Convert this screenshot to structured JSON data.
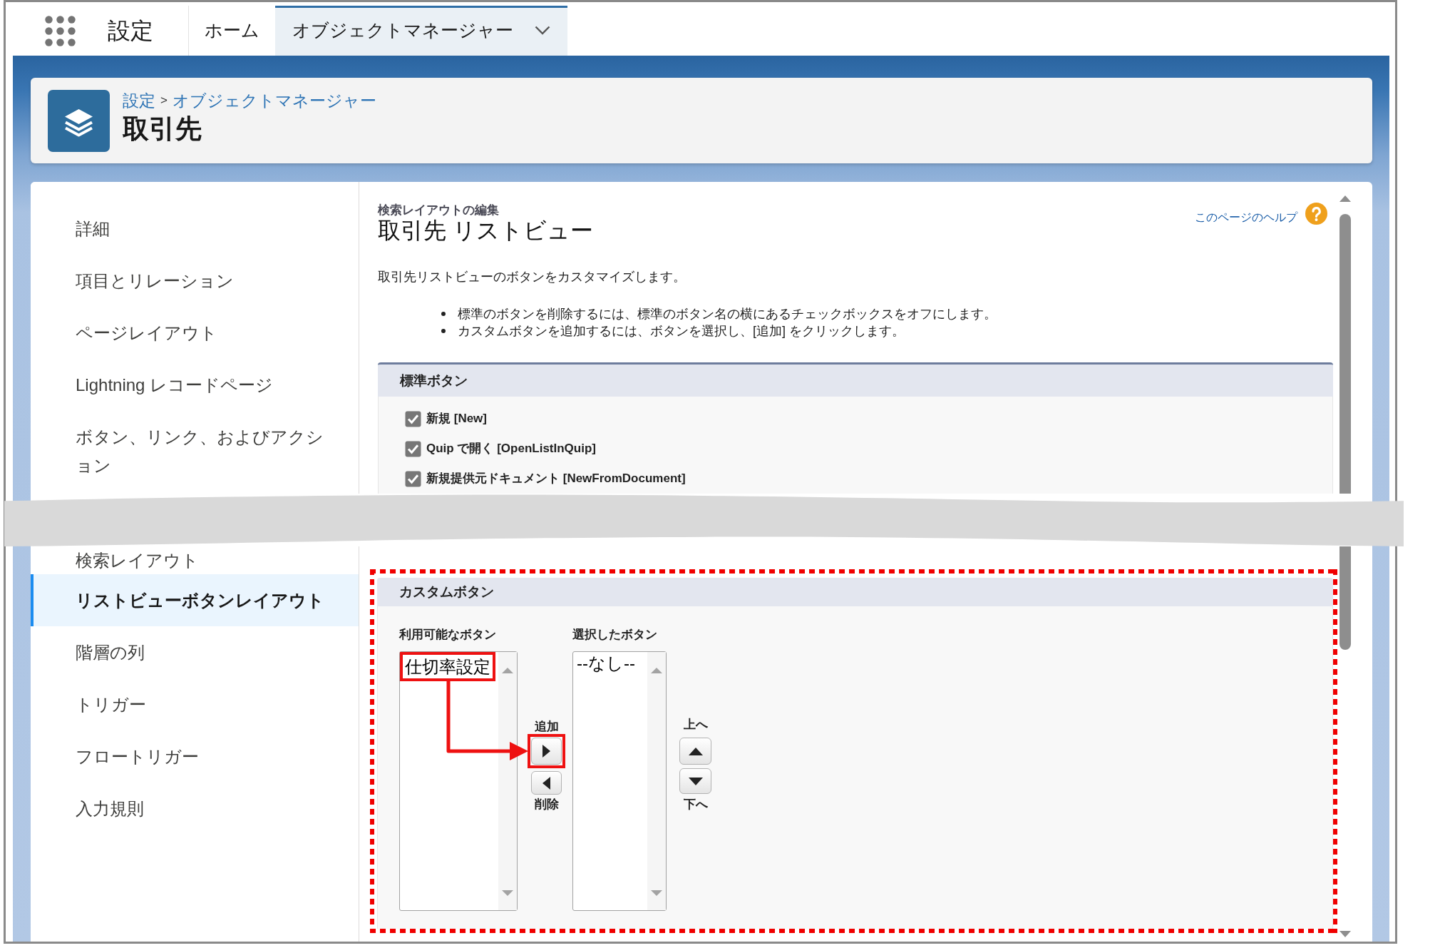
{
  "top_nav": {
    "app_name": "設定",
    "tabs": [
      {
        "label": "ホーム",
        "selected": false,
        "menu": false
      },
      {
        "label": "オブジェクトマネージャー",
        "selected": true,
        "menu": true
      }
    ]
  },
  "header": {
    "breadcrumb": [
      "設定",
      "オブジェクトマネージャー"
    ],
    "breadcrumb_separator": ">",
    "title": "取引先"
  },
  "sidebar": {
    "items_above_cut": [
      {
        "label": "詳細",
        "selected": false
      },
      {
        "label": "項目とリレーション",
        "selected": false
      },
      {
        "label": "ページレイアウト",
        "selected": false
      },
      {
        "label": "Lightning レコードページ",
        "selected": false
      },
      {
        "label": "ボタン、リンク、およびアクション",
        "selected": false
      }
    ],
    "items_below_cut": [
      {
        "label": "検索レイアウト",
        "selected": false
      },
      {
        "label": "リストビューボタンレイアウト",
        "selected": true
      },
      {
        "label": "階層の列",
        "selected": false
      },
      {
        "label": "トリガー",
        "selected": false
      },
      {
        "label": "フロートリガー",
        "selected": false
      },
      {
        "label": "入力規則",
        "selected": false
      }
    ]
  },
  "content": {
    "subtitle": "検索レイアウトの編集",
    "title": "取引先 リストビュー",
    "help_link": "このページのヘルプ",
    "description": "取引先リストビューのボタンをカスタマイズします。",
    "instructions": [
      "標準のボタンを削除するには、標準のボタン名の横にあるチェックボックスをオフにします。",
      "カスタムボタンを追加するには、ボタンを選択し、[追加] をクリックします。"
    ],
    "standard_buttons": {
      "title": "標準ボタン",
      "items": [
        {
          "label": "新規 [New]",
          "checked": true
        },
        {
          "label": "Quip で開く [OpenListInQuip]",
          "checked": true
        },
        {
          "label": "新規提供元ドキュメント [NewFromDocument]",
          "checked": true
        }
      ]
    },
    "custom_buttons": {
      "title": "カスタムボタン",
      "highlighted": true,
      "available": {
        "label": "利用可能なボタン",
        "options": [
          {
            "label": "仕切率設定",
            "highlighted": true
          }
        ]
      },
      "add": {
        "label": "追加",
        "highlighted": true
      },
      "remove": {
        "label": "削除"
      },
      "selected_list": {
        "label": "選択したボタン",
        "options": [
          {
            "label": "--なし--"
          }
        ]
      },
      "move_up": {
        "label": "上へ"
      },
      "move_down": {
        "label": "下へ"
      },
      "arrow_to_add": true
    }
  },
  "cut_band": true
}
